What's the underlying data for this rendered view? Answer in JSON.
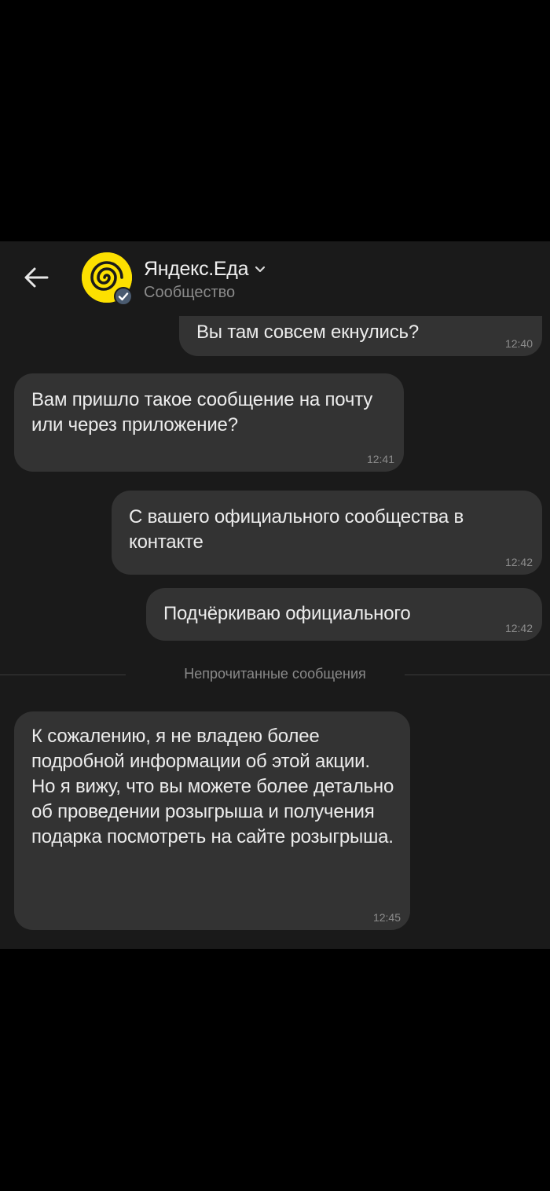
{
  "header": {
    "title": "Яндекс.Еда",
    "subtitle": "Сообщество",
    "brand_color": "#fce000",
    "back_icon": "arrow-left-icon",
    "dropdown_icon": "chevron-down-icon",
    "verified_icon": "check-badge-icon"
  },
  "messages": [
    {
      "text": "Вы там совсем екнулись?",
      "time": "12:40",
      "from": "me"
    },
    {
      "text": "Вам пришло такое сообщение на почту или через приложение?",
      "time": "12:41",
      "from": "community"
    },
    {
      "text": "С вашего официального сообщества в контакте",
      "time": "12:42",
      "from": "me"
    },
    {
      "text": "Подчёркиваю официального",
      "time": "12:42",
      "from": "me"
    },
    {
      "text": "К сожалению, я не владею более подробной информации об этой акции. Но я вижу, что вы можете более детально об проведении розыгрыша и получения подарка посмотреть на сайте розыгрыша.",
      "time": "12:45",
      "from": "community"
    }
  ],
  "unread_divider": "Непрочитанные сообщения",
  "colors": {
    "background": "#1a1a1a",
    "bubble": "#333333",
    "text": "#ececec",
    "muted": "#8a8a8a"
  }
}
